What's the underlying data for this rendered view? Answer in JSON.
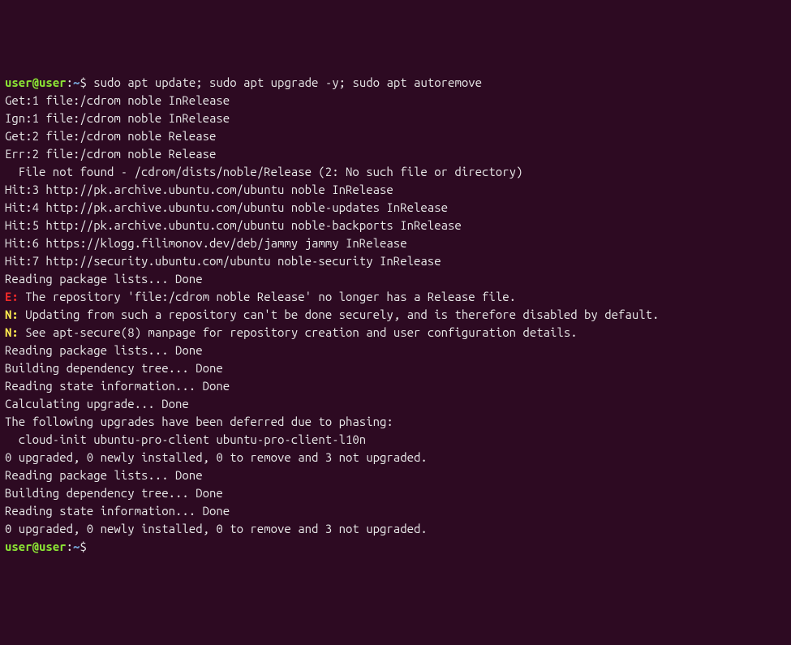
{
  "prompt": {
    "user": "user",
    "at": "@",
    "host": "user",
    "colon": ":",
    "path": "~",
    "symbol": "$"
  },
  "command1": "sudo apt update; sudo apt upgrade -y; sudo apt autoremove",
  "lines": [
    "Get:1 file:/cdrom noble InRelease",
    "Ign:1 file:/cdrom noble InRelease",
    "Get:2 file:/cdrom noble Release",
    "Err:2 file:/cdrom noble Release",
    "  File not found - /cdrom/dists/noble/Release (2: No such file or directory)",
    "Hit:3 http://pk.archive.ubuntu.com/ubuntu noble InRelease",
    "Hit:4 http://pk.archive.ubuntu.com/ubuntu noble-updates InRelease",
    "Hit:5 http://pk.archive.ubuntu.com/ubuntu noble-backports InRelease",
    "Hit:6 https://klogg.filimonov.dev/deb/jammy jammy InRelease",
    "Hit:7 http://security.ubuntu.com/ubuntu noble-security InRelease",
    "Reading package lists... Done"
  ],
  "err_line": {
    "prefix": "E:",
    "text": " The repository 'file:/cdrom noble Release' no longer has a Release file."
  },
  "notice_lines": [
    {
      "prefix": "N:",
      "text": " Updating from such a repository can't be done securely, and is therefore disabled by default."
    },
    {
      "prefix": "N:",
      "text": " See apt-secure(8) manpage for repository creation and user configuration details."
    }
  ],
  "lines2": [
    "Reading package lists... Done",
    "Building dependency tree... Done",
    "Reading state information... Done",
    "Calculating upgrade... Done",
    "The following upgrades have been deferred due to phasing:",
    "  cloud-init ubuntu-pro-client ubuntu-pro-client-l10n",
    "0 upgraded, 0 newly installed, 0 to remove and 3 not upgraded.",
    "Reading package lists... Done",
    "Building dependency tree... Done",
    "Reading state information... Done",
    "0 upgraded, 0 newly installed, 0 to remove and 3 not upgraded."
  ]
}
